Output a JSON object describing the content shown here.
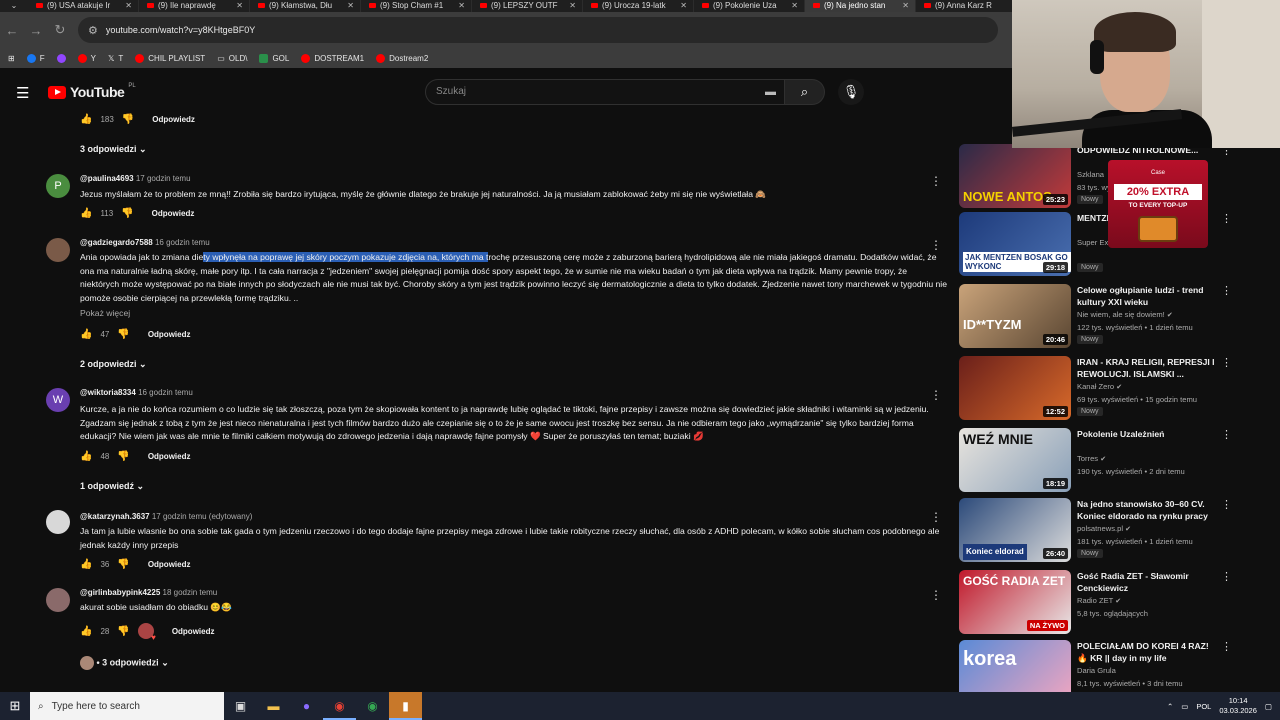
{
  "browser": {
    "tabs": [
      {
        "label": "(9) USA atakuje Ir"
      },
      {
        "label": "(9) Ile naprawdę"
      },
      {
        "label": "(9) Kłamstwa, Dłu"
      },
      {
        "label": "(9) Stop Cham #1"
      },
      {
        "label": "(9) LEPSZY OUTF"
      },
      {
        "label": "(9) Urocza 19-latk"
      },
      {
        "label": "(9) Pokolenie Uza"
      },
      {
        "label": "(9) Na jedno stan"
      },
      {
        "label": "(9) Anna Karz R"
      }
    ],
    "url": "youtube.com/watch?v=y8KHtgeBF0Y",
    "bookmarks": [
      {
        "label": "F",
        "icon": "facebook-icon",
        "color": "#1877f2"
      },
      {
        "label": "",
        "icon": "twitch-icon",
        "color": "#9146ff"
      },
      {
        "label": "Y",
        "icon": "youtube-icon",
        "color": "#ff0000"
      },
      {
        "label": "T",
        "icon": "x-icon",
        "color": "#ffffff"
      },
      {
        "label": "CHIL PLAYLIST",
        "icon": "youtube-icon",
        "color": "#ff0000"
      },
      {
        "label": "OLD\\",
        "icon": "folder-icon",
        "color": "#cccccc"
      },
      {
        "label": "GOL",
        "icon": "gol-icon",
        "color": "#2a8f4a"
      },
      {
        "label": "DOSTREAM1",
        "icon": "youtube-icon",
        "color": "#ff0000"
      },
      {
        "label": "Dostream2",
        "icon": "youtube-icon",
        "color": "#ff0000"
      }
    ]
  },
  "youtube": {
    "logo_text": "YouTube",
    "logo_region": "PL",
    "search_placeholder": "Szukaj"
  },
  "comments": {
    "top_actions": {
      "likes": "183",
      "reply": "Odpowiedz"
    },
    "top_replies": "3 odpowiedzi",
    "items": [
      {
        "author": "@paulina4693",
        "time": "17 godzin temu",
        "avatar_letter": "P",
        "avatar_color": "#4a8d3f",
        "text": "Jezus myślałam że to problem ze mną!! Zrobiła się bardzo irytująca, myślę że głównie dlatego że brakuje jej naturalności. Ja ją musiałam zablokować żeby mi się nie wyświetlała 🙈",
        "likes": "113",
        "reply": "Odpowiedz"
      },
      {
        "author": "@gadziegardo7588",
        "time": "16 godzin temu",
        "avatar_letter": "",
        "avatar_color": "#7a5a48",
        "text_before": "Ania opowiada jak to zmiana die",
        "text_highlight": "ty wpłynęła na poprawę jej skóry poczym pokazuje zdjęcia na, których ma t",
        "text_after": "rochę przesuszoną cerę może z zaburzoną barierą hydrolipidową ale nie miała jakiegoś dramatu. Dodatków widać, że ona ma naturalnie ładną skórę, małe pory itp. I ta cała narracja z \"jedzeniem\" swojej pielęgnacji pomija dość spory aspekt tego, że w sumie nie ma wieku badań o tym jak dieta wpływa na trądzik. Mamy pewnie tropy, że niektórych może występować po na białe innych po słodyczach ale nie musi tak być. Choroby skóry a tym jest trądzik powinno leczyć się dermatologicznie a dieta to tylko dodatek. Zjedzenie nawet tony marchewek w tygodniu nie pomoże osobie cierpiącej na przewlekłą formę trądziku. ..",
        "show_more": "Pokaż więcej",
        "likes": "47",
        "reply": "Odpowiedz",
        "replies": "2 odpowiedzi"
      },
      {
        "author": "@wiktoria8334",
        "time": "16 godzin temu",
        "avatar_letter": "W",
        "avatar_color": "#6a3fb0",
        "text": "Kurcze, a ja nie do końca rozumiem o co ludzie się tak złoszczą, poza tym że skopiowała kontent to ja naprawdę lubię oglądać te tiktoki, fajne przepisy i zawsze można się dowiedzieć jakie składniki i witaminki są w jedzeniu. Zgadzam się jednak z tobą z tym że jest nieco nienaturalna i jest tych filmów bardzo dużo ale czepianie się o to że je same owocu jest troszkę bez sensu. Ja nie odbieram tego jako „wymądrzanie\" się tylko bardziej forma edukacji? Nie wiem jak was ale mnie te filmiki całkiem motywują do zdrowego jedzenia i dają naprawdę fajne pomysły ❤️ Super że poruszyłaś ten temat; buziaki 💋",
        "likes": "48",
        "reply": "Odpowiedz",
        "replies": "1 odpowiedź"
      },
      {
        "author": "@katarzynah.3637",
        "time": "17 godzin temu (edytowany)",
        "avatar_letter": "",
        "avatar_color": "#c9c9c9",
        "text": "Ja tam ja lubie wlasnie bo ona sobie tak gada o tym jedzeniu rzeczowo i do tego dodaje fajne przepisy mega zdrowe i lubie takie robityczne rzeczy słuchać, dla osób z ADHD polecam, w kółko sobie słucham cos podobnego ale jednak każdy inny przepis",
        "likes": "36",
        "reply": "Odpowiedz"
      },
      {
        "author": "@girlinbabypink4225",
        "time": "18 godzin temu",
        "avatar_letter": "",
        "avatar_color": "#8a6a6a",
        "text": "akurat sobie usiadłam do obiadku 😊😂",
        "likes": "28",
        "reply": "Odpowiedz",
        "replies": "• 3 odpowiedzi"
      }
    ]
  },
  "sidebar": {
    "items": [
      {
        "title": "ODPOWIEDŹ NITROLNOWE...",
        "channel": "Szklana",
        "meta": "83 tys. wyświetleń",
        "badge": "Nowy",
        "duration": "25:23",
        "thumb_caption": "NOWE ANTOS",
        "thumb_color": "#2a2a48"
      },
      {
        "title": "MENTZEN i BOSAK. PREMIERA",
        "channel": "Super Ex",
        "meta": "",
        "badge": "Nowy",
        "duration": "29:18",
        "thumb_caption": "JAK MENTZEN BOSAK GO WYKONC",
        "thumb_color": "#1d3a7a"
      },
      {
        "title": "Celowe ogłupianie ludzi - trend kultury XXI wieku",
        "channel": "Nie wiem, ale się dowiem!",
        "meta": "122 tys. wyświetleń • 1 dzień temu",
        "badge": "Nowy",
        "duration": "20:46",
        "thumb_caption": "ID**TYZM",
        "thumb_color": "#5a4632"
      },
      {
        "title": "IRAN - KRAJ RELIGII, REPRESJI I REWOLUCJI. ISLAMSKI ...",
        "channel": "Kanał Zero",
        "meta": "69 tys. wyświetleń • 15 godzin temu",
        "badge": "Nowy",
        "duration": "12:52",
        "thumb_caption": "",
        "thumb_color": "#6a1f1a"
      },
      {
        "title": "Pokolenie Uzależnień",
        "channel": "Torres",
        "meta": "190 tys. wyświetleń • 2 dni temu",
        "badge": "",
        "duration": "18:19",
        "thumb_caption": "WEŹ MNIE",
        "thumb_color": "#d6d2cc"
      },
      {
        "title": "Na jedno stanowisko 30–60 CV. Koniec eldorado na rynku pracy",
        "channel": "polsatnews.pl",
        "meta": "181 tys. wyświetleń • 1 dzień temu",
        "badge": "Nowy",
        "duration": "26:40",
        "thumb_caption": "Koniec eldorad",
        "thumb_color": "#2c4a7a"
      },
      {
        "title": "Gość Radia ZET - Sławomir Cenckiewicz",
        "channel": "Radio ZET",
        "meta": "5,8 tys. oglądających",
        "badge": "",
        "duration": "NA ŻYWO",
        "thumb_caption": "GOŚĆ RADIA ZET",
        "thumb_color": "#c0182a"
      },
      {
        "title": "POLECIAŁAM DO KOREI 4 RAZ! 🔥 KR || day in my life",
        "channel": "Daria Grula",
        "meta": "8,1 tys. wyświetleń • 3 dni temu",
        "badge": "",
        "duration": "",
        "thumb_caption": "korea",
        "thumb_color": "#5a8ad6"
      }
    ]
  },
  "overlay_ad": {
    "brand": "Case",
    "headline": "20% EXTRA",
    "sub": "TO EVERY TOP-UP"
  },
  "taskbar": {
    "search_placeholder": "Type here to search",
    "lang": "POL",
    "time": "10:14",
    "date": "03.03.2026"
  }
}
